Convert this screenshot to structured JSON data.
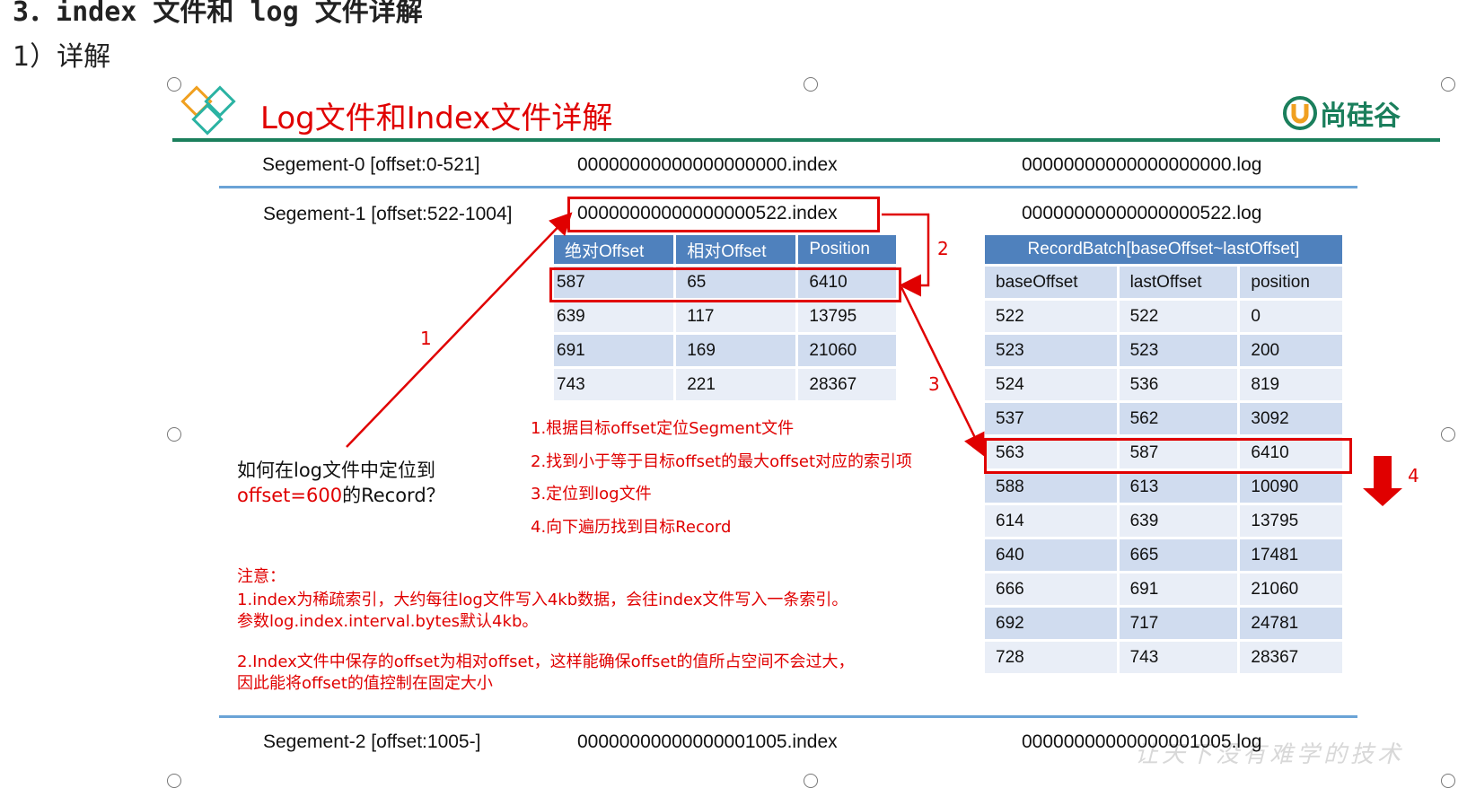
{
  "doc": {
    "heading": "3．index 文件和 log 文件详解",
    "subheading": "1）详解"
  },
  "slide": {
    "title": "Log文件和Index文件详解",
    "brand": "尚硅谷",
    "watermark": "让天下没有难学的技术"
  },
  "segments": [
    {
      "label": "Segement-0 [offset:0-521]",
      "index_file": "00000000000000000000.index",
      "log_file": "00000000000000000000.log"
    },
    {
      "label": "Segement-1 [offset:522-1004]",
      "index_file": "00000000000000000522.index",
      "log_file": "00000000000000000522.log"
    },
    {
      "label": "Segement-2 [offset:1005-]",
      "index_file": "00000000000000001005.index",
      "log_file": "00000000000000001005.log"
    }
  ],
  "index_table": {
    "headers": [
      "绝对Offset",
      "相对Offset",
      "Position"
    ],
    "rows": [
      [
        "587",
        "65",
        "6410"
      ],
      [
        "639",
        "117",
        "13795"
      ],
      [
        "691",
        "169",
        "21060"
      ],
      [
        "743",
        "221",
        "28367"
      ]
    ]
  },
  "log_table": {
    "title": "RecordBatch[baseOffset~lastOffset]",
    "headers": [
      "baseOffset",
      "lastOffset",
      "position"
    ],
    "rows": [
      [
        "522",
        "522",
        "0"
      ],
      [
        "523",
        "523",
        "200"
      ],
      [
        "524",
        "536",
        "819"
      ],
      [
        "537",
        "562",
        "3092"
      ],
      [
        "563",
        "587",
        "6410"
      ],
      [
        "588",
        "613",
        "10090"
      ],
      [
        "614",
        "639",
        "13795"
      ],
      [
        "640",
        "665",
        "17481"
      ],
      [
        "666",
        "691",
        "21060"
      ],
      [
        "692",
        "717",
        "24781"
      ],
      [
        "728",
        "743",
        "28367"
      ]
    ]
  },
  "steps": [
    "1.根据目标offset定位Segment文件",
    "2.找到小于等于目标offset的最大offset对应的索引项",
    "3.定位到log文件",
    "4.向下遍历找到目标Record"
  ],
  "question": {
    "line1": "如何在log文件中定位到",
    "line2_red": "offset=600",
    "line2_rest": "的Record？"
  },
  "notes": {
    "title": "注意：",
    "n1a": "1.index为稀疏索引，大约每往log文件写入4kb数据，会往index文件写入一条索引。",
    "n1b": "参数log.index.interval.bytes默认4kb。",
    "n2a": "2.Index文件中保存的offset为相对offset，这样能确保offset的值所占空间不会过大，",
    "n2b": "因此能将offset的值控制在固定大小"
  },
  "arrow_labels": [
    "1",
    "2",
    "3",
    "4"
  ],
  "colors": {
    "accent_red": "#e00000",
    "header_blue": "#4f81bd",
    "row_odd": "#d0dcef",
    "row_even": "#e9eef7",
    "brand_green": "#1b7f5c",
    "rule_blue": "#6aa3d6"
  }
}
